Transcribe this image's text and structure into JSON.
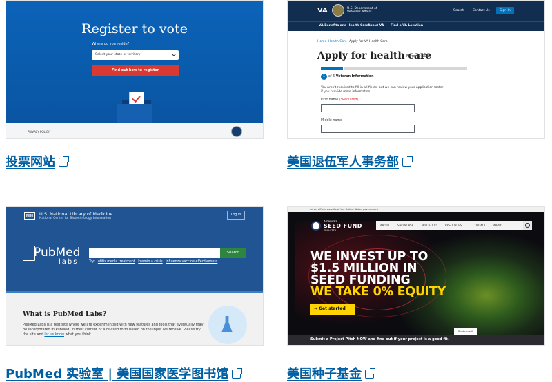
{
  "cards": [
    {
      "caption": "投票网站",
      "vote": {
        "title": "Register to vote",
        "question": "Where do you reside?",
        "select": "Select your state or territory",
        "button": "Find out how to register",
        "footer": "PRIVACY POLICY"
      }
    },
    {
      "caption": "美国退伍军人事务部",
      "va": {
        "logo": "VA",
        "dept": "U.S. Department of Veterans Affairs",
        "search": "Search",
        "contact": "Contact Us",
        "signin": "Sign In",
        "nav": [
          "VA Benefits and Health Care",
          "About VA",
          "Find a VA Location"
        ],
        "breadcrumb": [
          "Home",
          "Health Care",
          "Apply for VA Health Care"
        ],
        "title": "Apply for health care",
        "form": "Form 10-10EZ",
        "step_num": "1",
        "step_of": "of 6",
        "step_title": "Veteran Information",
        "note": "You aren't required to fill in all fields, but we can review your application faster if you provide more information.",
        "first_name": "First name",
        "required": "(*Required)",
        "middle_name": "Middle name"
      }
    },
    {
      "caption": "PubMed 实验室 | 美国国家医学图书馆",
      "pubmed": {
        "nih": "NIH",
        "nlm": "U.S. National Library of Medicine",
        "ncbi": "National Center for Biotechnology Information",
        "login": "Log in",
        "logo": "PubMed",
        "labs": "labs",
        "search_button": "Search",
        "try": "Try:",
        "try_links": [
          "otitis media treatment",
          "kosmin a crisis",
          "influenza vaccine effectiveness"
        ],
        "heading": "What is PubMed Labs?",
        "desc_1": "PubMed Labs is a test site where we are experimenting with new features and tools that eventually may be incorporated in PubMed, in their current or a revised form based on the input we receive. Please try the site and",
        "desc_link": "let us know",
        "desc_2": "what you think."
      }
    },
    {
      "caption": "美国种子基金",
      "seed": {
        "gov_banner": "An official website of the United States government",
        "brand_top": "America's",
        "brand_main": "SEED FUND",
        "brand_sub": "SBIR·STTR",
        "menu": [
          "ABOUT",
          "SHOWCASE",
          "PORTFOLIO",
          "RESOURCES",
          "CONTACT",
          "APPLY"
        ],
        "headline": [
          "WE INVEST UP TO",
          "$1.5 MILLION IN",
          "SEED FUNDING"
        ],
        "headline_yellow": "WE TAKE 0% EQUITY",
        "cta": "→ Get started",
        "credit": "Photo credit",
        "bottom": "Submit a Project Pitch NOW and find out if your project is a good fit."
      }
    }
  ]
}
